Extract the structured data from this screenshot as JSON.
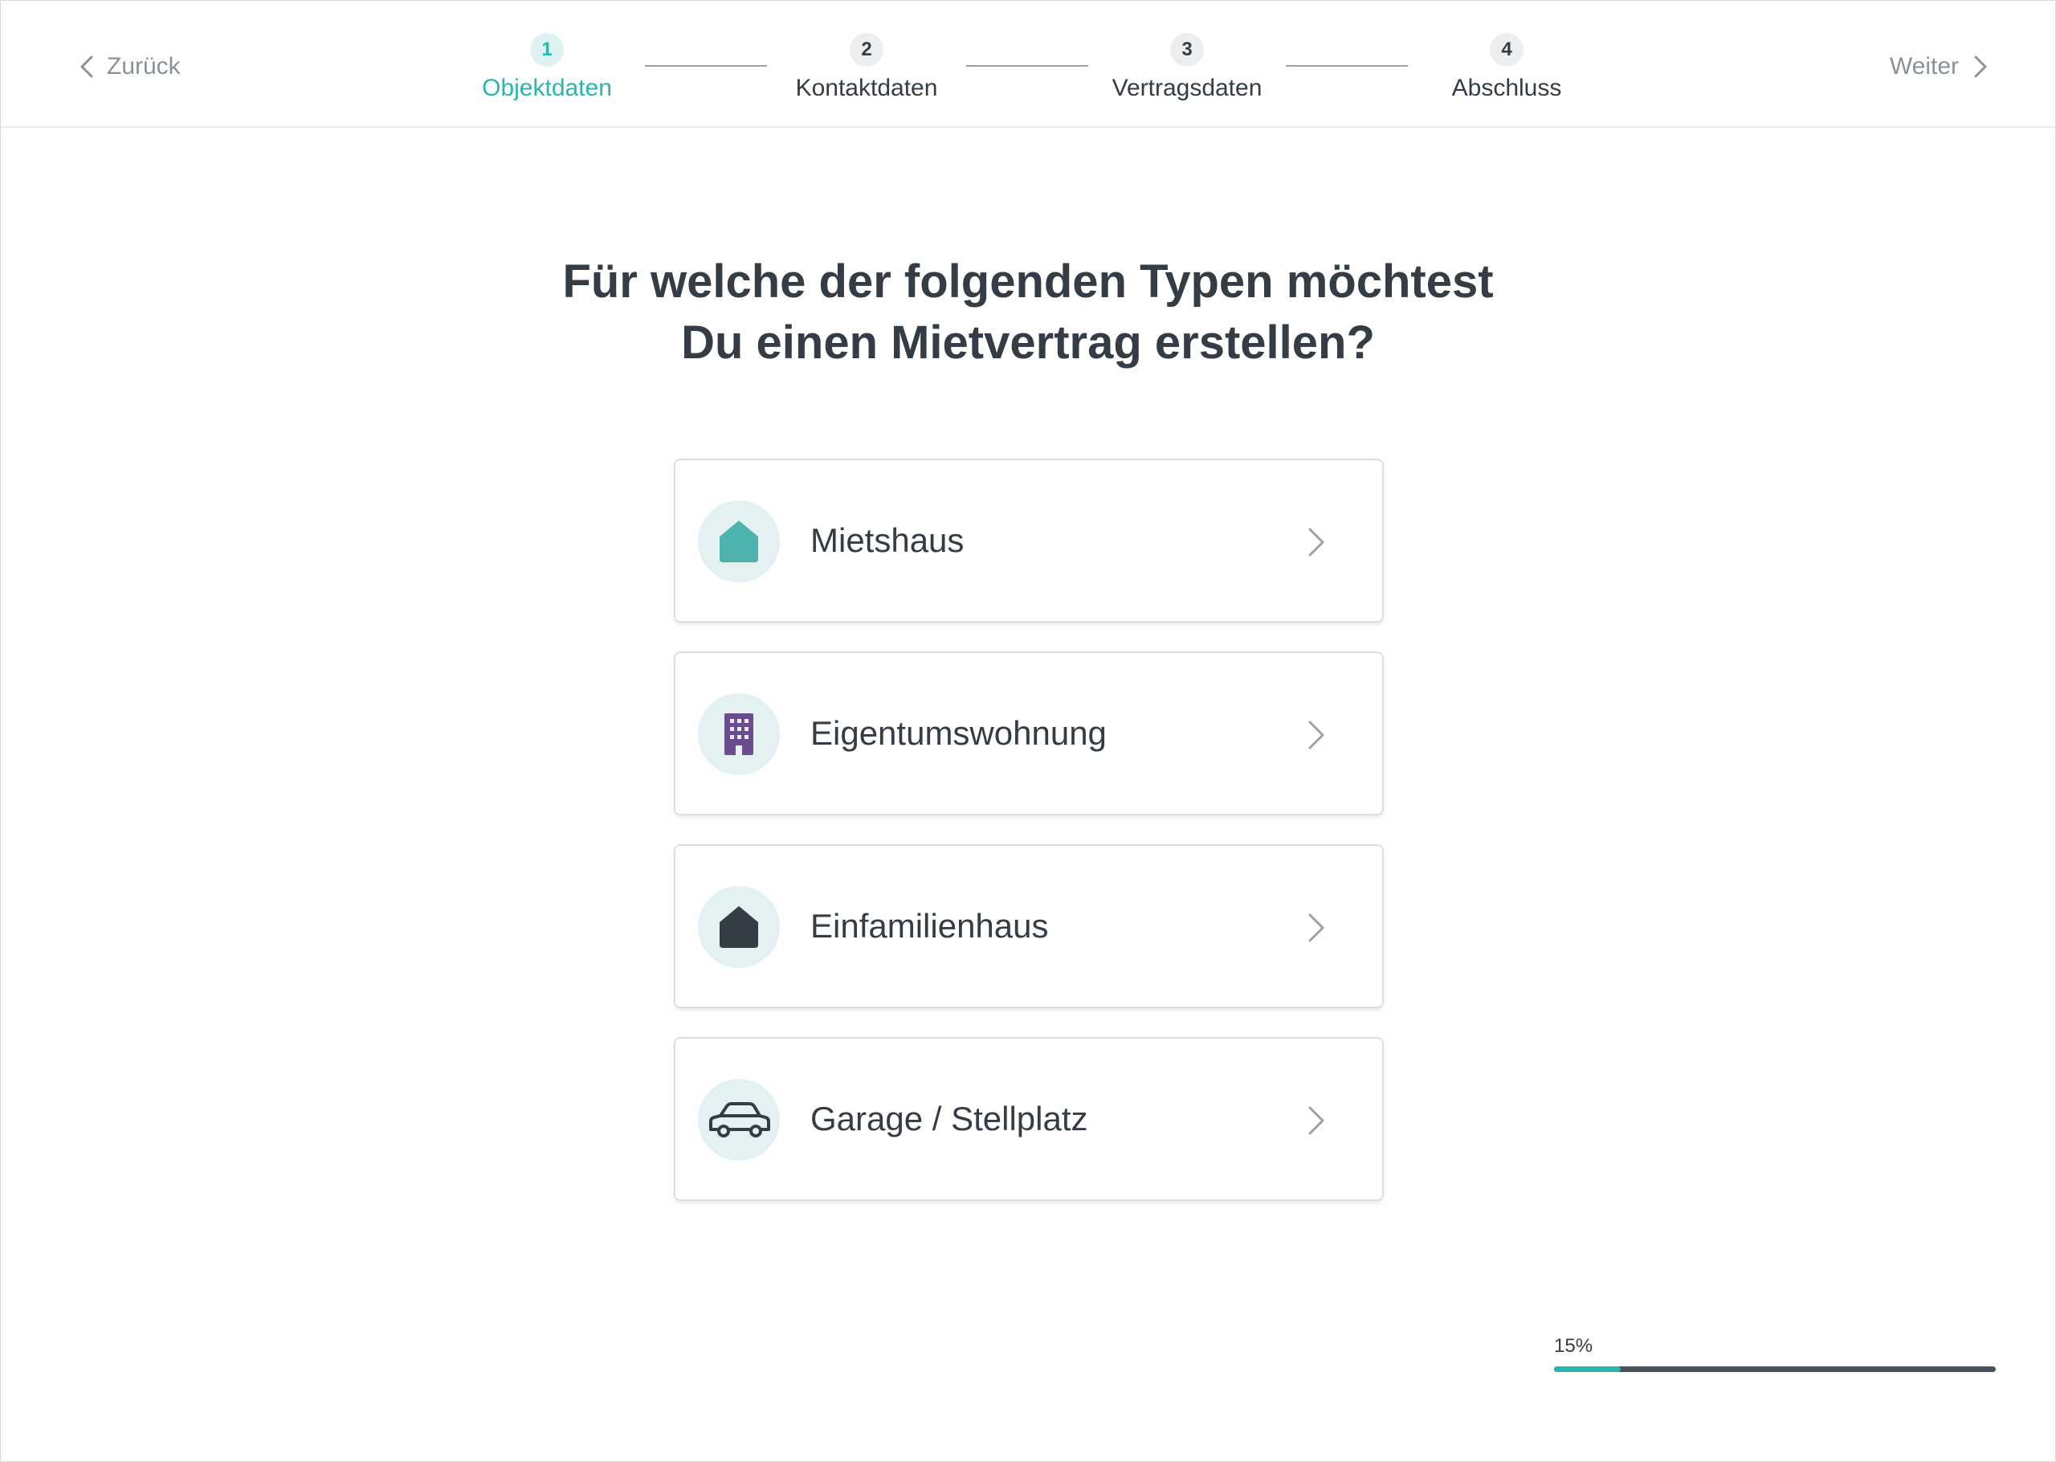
{
  "nav": {
    "back_label": "Zurück",
    "next_label": "Weiter"
  },
  "stepper": {
    "active_step": 1,
    "steps": [
      {
        "number": "1",
        "label": "Objektdaten"
      },
      {
        "number": "2",
        "label": "Kontaktdaten"
      },
      {
        "number": "3",
        "label": "Vertragsdaten"
      },
      {
        "number": "4",
        "label": "Abschluss"
      }
    ]
  },
  "main": {
    "title_line1": "Für welche der folgenden Typen möchtest",
    "title_line2": "Du einen Mietvertrag erstellen?",
    "options": [
      {
        "label": "Mietshaus",
        "icon": "house-icon",
        "icon_color": "#4fb3ad"
      },
      {
        "label": "Eigentumswohnung",
        "icon": "apartment-building-icon",
        "icon_color": "#6b4d8f"
      },
      {
        "label": "Einfamilienhaus",
        "icon": "house-icon",
        "icon_color": "#343c45"
      },
      {
        "label": "Garage / Stellplatz",
        "icon": "car-icon",
        "icon_color": "#343c45"
      }
    ]
  },
  "progress": {
    "text": "15%",
    "value": 0.15
  },
  "colors": {
    "accent": "#2bb5ad",
    "text": "#343c45",
    "muted": "#8a9199",
    "icon_bg": "#e3f1f2"
  }
}
